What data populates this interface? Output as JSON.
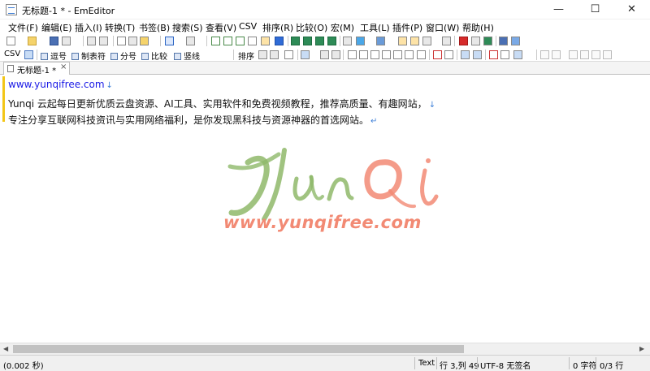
{
  "window": {
    "title": "无标题-1 * - EmEditor",
    "minimize": "—",
    "maximize": "☐",
    "close": "✕"
  },
  "menu": [
    "文件(F)",
    "编辑(E)",
    "插入(I)",
    "转换(T)",
    "书签(B)",
    "搜索(S)",
    "查看(V)",
    "CSV",
    "排序(R)",
    "比较(O)",
    "宏(M)",
    "工具(L)",
    "插件(P)",
    "窗口(W)",
    "帮助(H)"
  ],
  "toolbar2": {
    "csv": "CSV",
    "comma": "逗号",
    "tab_sep": "制表符",
    "semicolon": "分号",
    "compare": "比较",
    "vertical_line": "竖线",
    "sort": "排序"
  },
  "tab": {
    "label": "无标题-1 *",
    "close": "×"
  },
  "editor": {
    "lines": [
      "www.yunqifree.com",
      "Yunqi 云起每日更新优质云盘资源、AI工具、实用软件和免费视频教程，推荐高质量、有趣网站，",
      "专注分享互联网科技资讯与实用网络福利，是你发现黑科技与资源神器的首选网站。"
    ],
    "eol_glyph": "↓",
    "eof_glyph": "↵"
  },
  "watermark": {
    "url": "www.yunqifree.com",
    "colors": {
      "green": "#8fb96a",
      "orange": "#f28a74"
    }
  },
  "status": {
    "time": "(0.002 秒)",
    "mode": "Text",
    "position": "行 3,列 49",
    "encoding": "UTF-8 无签名",
    "chars": "0 字符",
    "lines": "0/3 行"
  }
}
